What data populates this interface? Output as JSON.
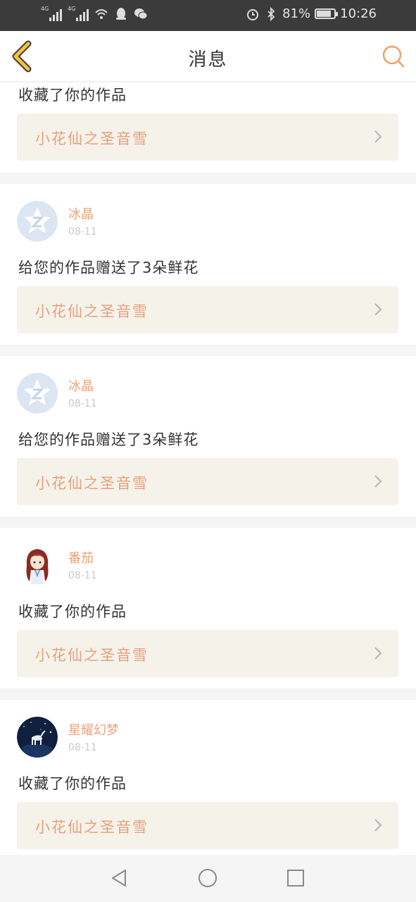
{
  "status_bar": {
    "network_1": "4G",
    "network_2": "4G",
    "battery_text": "81%",
    "battery_level": 0.81,
    "time": "10:26"
  },
  "header": {
    "title": "消息"
  },
  "colors": {
    "accent": "#e9a37a",
    "back_icon": "#f2bf3f",
    "card_work_bg": "#f5f2ea"
  },
  "notifications": [
    {
      "user": "",
      "date": "",
      "message": "收藏了你的作品",
      "work_title": "小花仙之圣音雪"
    },
    {
      "user": "冰晶",
      "date": "08-11",
      "message": "给您的作品赠送了3朵鲜花",
      "work_title": "小花仙之圣音雪",
      "avatar": "default-avatar-icon"
    },
    {
      "user": "冰晶",
      "date": "08-11",
      "message": "给您的作品赠送了3朵鲜花",
      "work_title": "小花仙之圣音雪",
      "avatar": "default-avatar-icon"
    },
    {
      "user": "番茄",
      "date": "08-11",
      "message": "收藏了你的作品",
      "work_title": "小花仙之圣音雪",
      "avatar": "anime-girl-avatar"
    },
    {
      "user": "星耀幻梦",
      "date": "08-11",
      "message": "收藏了你的作品",
      "work_title": "小花仙之圣音雪",
      "avatar": "night-sky-deer-avatar"
    }
  ]
}
